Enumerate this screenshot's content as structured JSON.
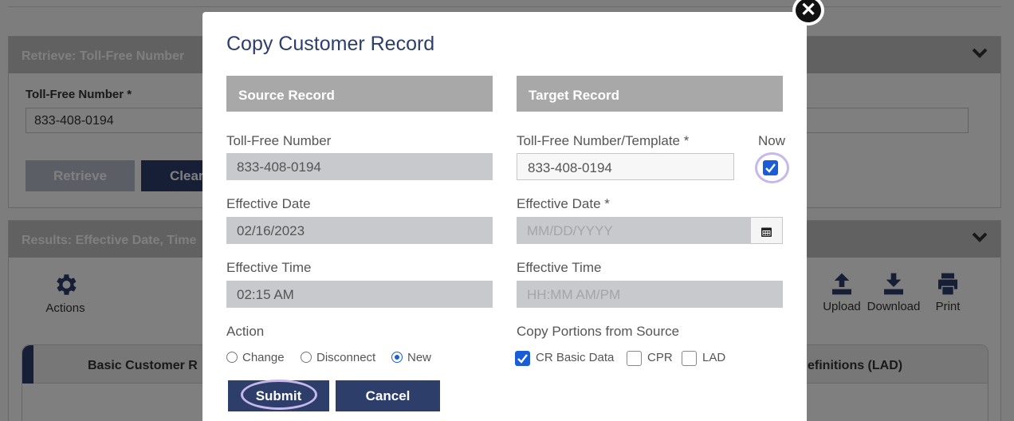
{
  "background": {
    "retrieve_panel": {
      "title": "Retrieve: Toll-Free Number",
      "field_label": "Toll-Free Number *",
      "field_value": "833-408-0194",
      "retrieve_label": "Retrieve",
      "clear_label": "Clear"
    },
    "results_panel": {
      "title": "Results: Effective Date, Time",
      "actions": {
        "actions_label": "Actions",
        "upload_label": "Upload",
        "download_label": "Download",
        "print_label": "Print"
      },
      "tabs": {
        "basic": "Basic Customer R",
        "lad": "efinitions (LAD)"
      }
    }
  },
  "modal": {
    "title": "Copy Customer Record",
    "source": {
      "header": "Source Record",
      "tfn_label": "Toll-Free Number",
      "tfn_value": "833-408-0194",
      "date_label": "Effective Date",
      "date_value": "02/16/2023",
      "time_label": "Effective Time",
      "time_value": "02:15 AM",
      "action_label": "Action",
      "actions": [
        "Change",
        "Disconnect",
        "New"
      ],
      "selected_action": "New"
    },
    "target": {
      "header": "Target Record",
      "tfn_label": "Toll-Free Number/Template *",
      "tfn_value": "833-408-0194",
      "now_label": "Now",
      "now_checked": true,
      "date_label": "Effective Date *",
      "date_placeholder": "MM/DD/YYYY",
      "time_label": "Effective Time",
      "time_placeholder": "HH:MM AM/PM",
      "portions_label": "Copy Portions from Source",
      "portions": [
        {
          "label": "CR Basic Data",
          "checked": true
        },
        {
          "label": "CPR",
          "checked": false
        },
        {
          "label": "LAD",
          "checked": false
        }
      ]
    },
    "submit_label": "Submit",
    "cancel_label": "Cancel"
  },
  "colors": {
    "primary": "#2d3e6a",
    "checkbox": "#1a5dd6",
    "focus_ring": "#c6b8e8",
    "section_header": "#a8a8a8"
  }
}
